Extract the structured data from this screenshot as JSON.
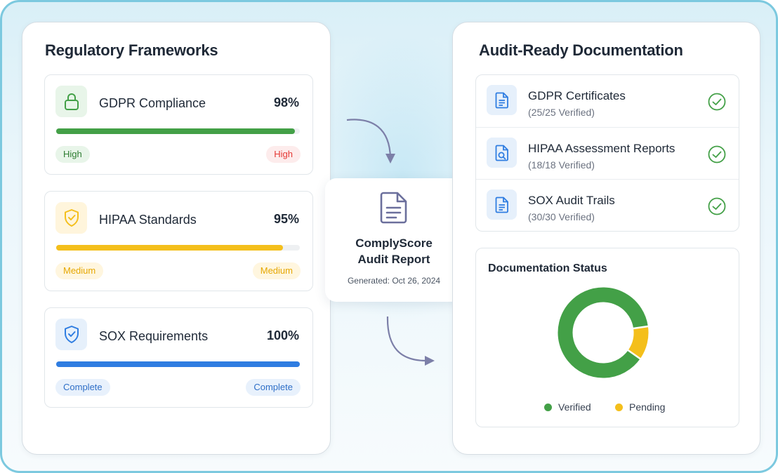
{
  "left_panel": {
    "title": "Regulatory Frameworks",
    "frameworks": [
      {
        "name": "GDPR Compliance",
        "percent_label": "98%",
        "progress": 0.98,
        "icon": "lock-icon",
        "color": "#43a047",
        "icon_bg": "#e8f5e9",
        "left_tag": "High",
        "left_tag_color": "#2e7d32",
        "left_tag_bg": "#e8f5e9",
        "right_tag": "High",
        "right_tag_color": "#e53935",
        "right_tag_bg": "#fdecec"
      },
      {
        "name": "HIPAA Standards",
        "percent_label": "95%",
        "progress": 0.93,
        "icon": "shield-check-icon",
        "color": "#f4bf1b",
        "icon_bg": "#fff5dc",
        "left_tag": "Medium",
        "left_tag_color": "#e6a700",
        "left_tag_bg": "#fff6df",
        "right_tag": "Medium",
        "right_tag_color": "#e6a700",
        "right_tag_bg": "#fff6df"
      },
      {
        "name": "SOX Requirements",
        "percent_label": "100%",
        "progress": 1.0,
        "icon": "shield-check-icon",
        "color": "#2f7de1",
        "icon_bg": "#e6f0fb",
        "left_tag": "Complete",
        "left_tag_color": "#2f6fc7",
        "left_tag_bg": "#e8f1fc",
        "right_tag": "Complete",
        "right_tag_color": "#2f6fc7",
        "right_tag_bg": "#e8f1fc"
      }
    ]
  },
  "center": {
    "title_line1": "ComplyScore",
    "title_line2": "Audit Report",
    "generated": "Generated: Oct 26, 2024",
    "icon": "document-icon"
  },
  "right_panel": {
    "title": "Audit-Ready Documentation",
    "documents": [
      {
        "title": "GDPR Certificates",
        "subtitle": "(25/25 Verified)",
        "icon": "document-icon"
      },
      {
        "title": "HIPAA Assessment Reports",
        "subtitle": "(18/18 Verified)",
        "icon": "document-search-icon"
      },
      {
        "title": "SOX Audit Trails",
        "subtitle": "(30/30 Verified)",
        "icon": "document-icon"
      }
    ],
    "status": {
      "title": "Documentation Status",
      "legend": [
        {
          "label": "Verified",
          "color": "#43a047"
        },
        {
          "label": "Pending",
          "color": "#f4bf1b"
        }
      ]
    }
  },
  "colors": {
    "check": "#43a047",
    "doc_icon": "#2f7de1",
    "arrow": "#7c7fa8"
  },
  "chart_data": {
    "type": "pie",
    "title": "Documentation Status",
    "categories": [
      "Verified",
      "Pending"
    ],
    "values": [
      88,
      12
    ],
    "legend": "bottom"
  }
}
